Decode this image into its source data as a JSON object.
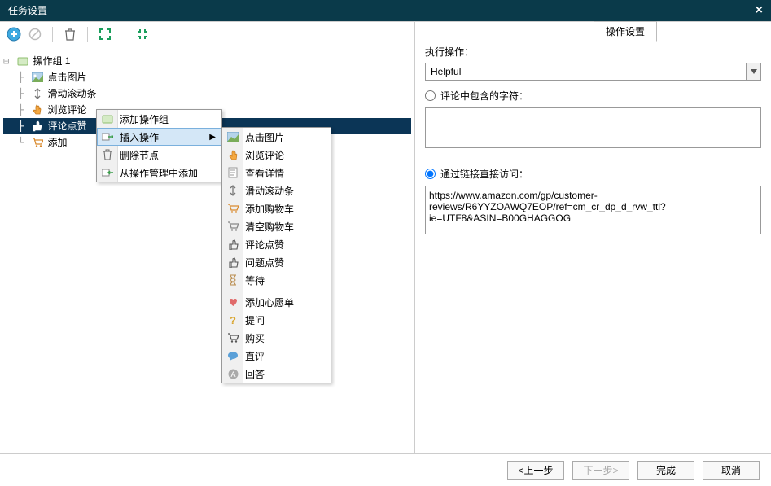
{
  "title": "任务设置",
  "right": {
    "tab": "操作设置",
    "exec_label": "执行操作：",
    "exec_value": "Helpful",
    "radio_contains": "评论中包含的字符：",
    "contains_value": "",
    "radio_link": "通过链接直接访问：",
    "link_value": "https://www.amazon.com/gp/customer-reviews/R6YYZOAWQ7EOP/ref=cm_cr_dp_d_rvw_ttl?ie=UTF8&ASIN=B00GHAGGOG"
  },
  "tree": {
    "root": "操作组 1",
    "items": [
      "点击图片",
      "滑动滚动条",
      "浏览评论",
      "评论点赞",
      "添加"
    ]
  },
  "ctx_main": {
    "items": [
      "添加操作组",
      "插入操作",
      "删除节点",
      "从操作管理中添加"
    ]
  },
  "ctx_sub": {
    "group1": [
      "点击图片",
      "浏览评论",
      "查看详情",
      "滑动滚动条",
      "添加购物车",
      "清空购物车",
      "评论点赞",
      "问题点赞",
      "等待"
    ],
    "group2": [
      "添加心愿单",
      "提问",
      "购买",
      "直评",
      "回答"
    ]
  },
  "footer": {
    "prev": "<上一步",
    "next": "下一步>",
    "finish": "完成",
    "cancel": "取消"
  }
}
